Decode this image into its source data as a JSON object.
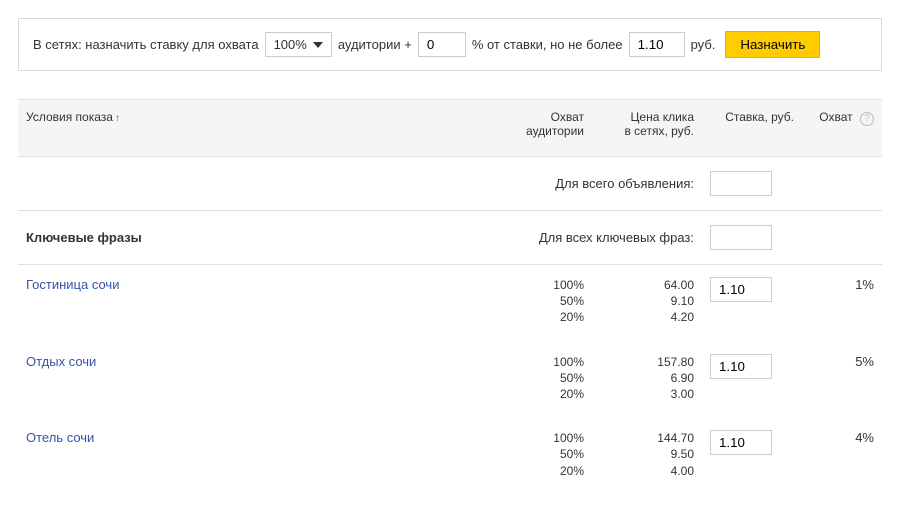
{
  "toolbar": {
    "prefix": "В сетях:  назначить ставку для охвата",
    "coverage_select": "100%",
    "mid1": "аудитории +",
    "plus_value": "0",
    "mid2": "% от ставки, но не более",
    "max_bid": "1.10",
    "suffix": "руб.",
    "button": "Назначить"
  },
  "headers": {
    "term": "Условия показа",
    "sort_indicator": "↑",
    "coverage_l1": "Охват",
    "coverage_l2": "аудитории",
    "price_l1": "Цена клика",
    "price_l2": "в сетях, руб.",
    "bid": "Ставка, руб.",
    "reach": "Охват"
  },
  "agg": {
    "all_ad_label": "Для всего объявления:",
    "all_ad_value": "",
    "keywords_title": "Ключевые фразы",
    "all_keywords_label": "Для всех ключевых фраз:",
    "all_keywords_value": ""
  },
  "rows": [
    {
      "term": "Гостиница сочи",
      "coverage": [
        "100%",
        "50%",
        "20%"
      ],
      "price": [
        "64.00",
        "9.10",
        "4.20"
      ],
      "bid": "1.10",
      "reach": "1%"
    },
    {
      "term": "Отдых сочи",
      "coverage": [
        "100%",
        "50%",
        "20%"
      ],
      "price": [
        "157.80",
        "6.90",
        "3.00"
      ],
      "bid": "1.10",
      "reach": "5%"
    },
    {
      "term": "Отель сочи",
      "coverage": [
        "100%",
        "50%",
        "20%"
      ],
      "price": [
        "144.70",
        "9.50",
        "4.00"
      ],
      "bid": "1.10",
      "reach": "4%"
    }
  ]
}
